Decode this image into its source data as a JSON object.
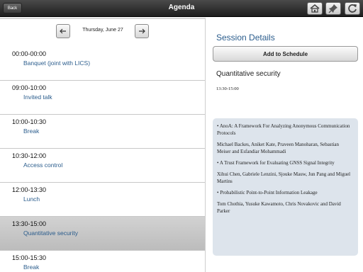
{
  "header": {
    "back_label": "Back",
    "title": "Agenda",
    "icons": [
      "home-icon",
      "pin-icon",
      "refresh-icon"
    ]
  },
  "datebar": {
    "date": "Thursday, June 27"
  },
  "sessions": [
    {
      "time": "00:00-00:00",
      "name": "Banquet (joint with LICS)"
    },
    {
      "time": "09:00-10:00",
      "name": "Invited talk"
    },
    {
      "time": "10:00-10:30",
      "name": "Break"
    },
    {
      "time": "10:30-12:00",
      "name": "Access control"
    },
    {
      "time": "12:00-13:30",
      "name": "Lunch"
    },
    {
      "time": "13:30-15:00",
      "name": "Quantitative security"
    },
    {
      "time": "15:00-15:30",
      "name": "Break"
    }
  ],
  "selected_session_index": 5,
  "details": {
    "heading": "Session Details",
    "add_button": "Add to Schedule",
    "session_title": "Quantitative security",
    "session_time": "13:30-15:00",
    "papers": [
      {
        "title": "• AnoA: A Framework For Analyzing Anonymous Communication Protocols",
        "authors": "Michael Backes, Aniket Kate, Praveen Manoharan, Sebastian Meiser and Esfandiar Mohammadi"
      },
      {
        "title": "• A Trust Framework for Evaluating GNSS Signal Integrity",
        "authors": "Xihui Chen, Gabriele Lenzini, Sjouke Mauw, Jun Pang and Miguel Martins"
      },
      {
        "title": "• Probabilistic Point-to-Point Information Leakage",
        "authors": "Tom Chothia, Yusuke Kawamoto, Chris Novakovic and David Parker"
      }
    ]
  },
  "colors": {
    "accent": "#2a5c8c",
    "selected_row": "#c4c4c4",
    "papers_background": "#dde4ec"
  }
}
